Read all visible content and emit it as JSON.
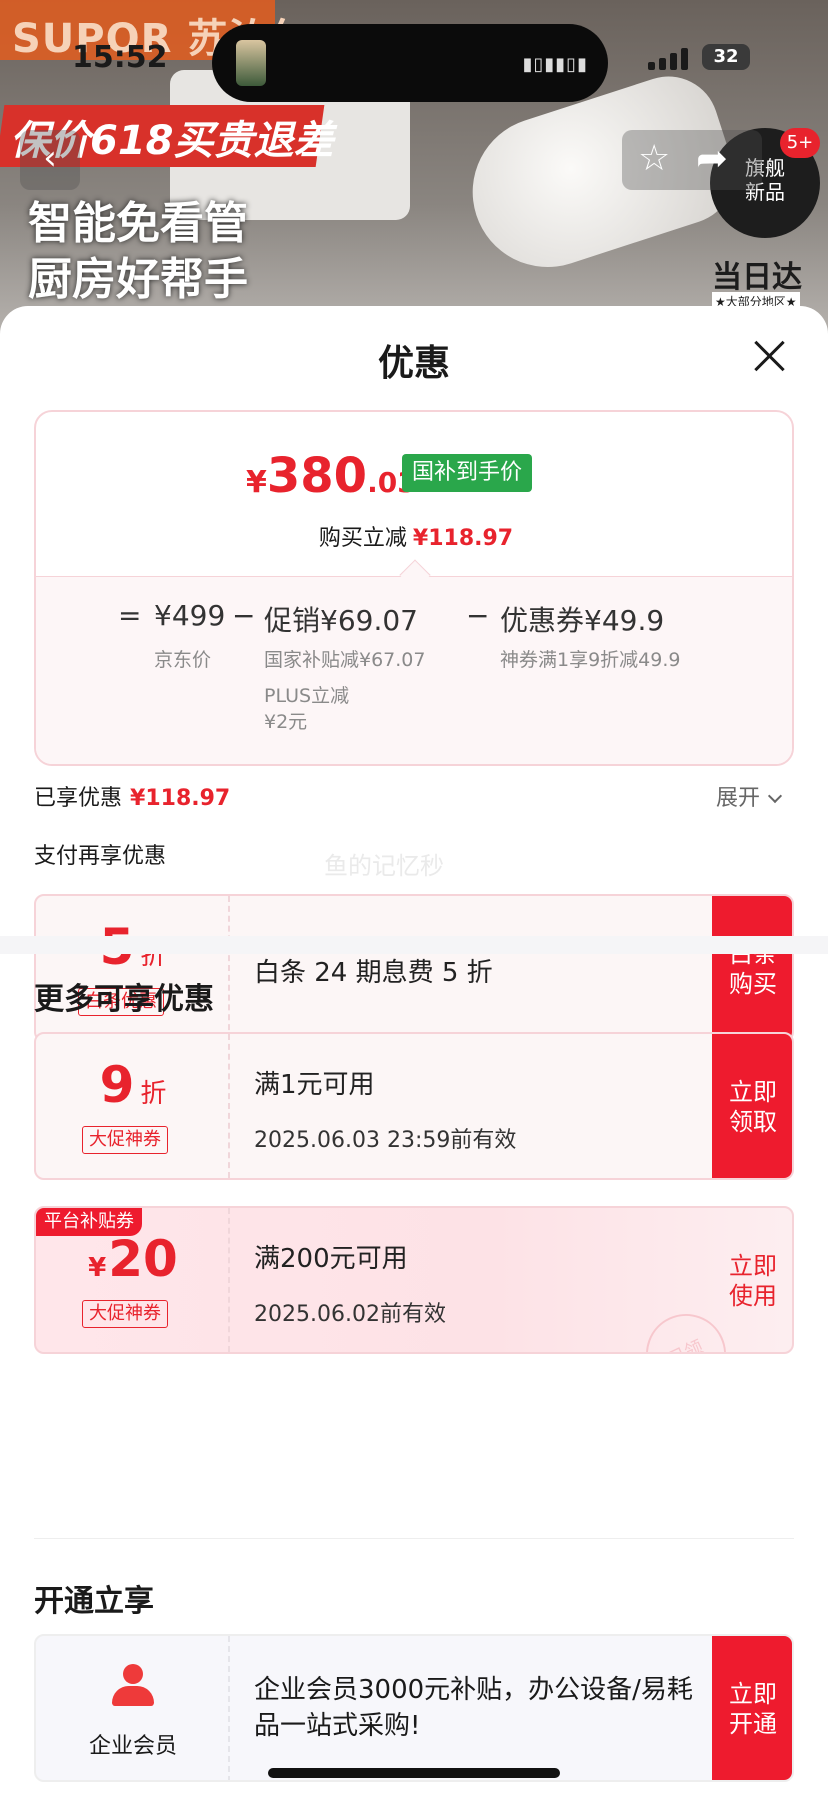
{
  "status_bar": {
    "time": "15:52",
    "battery": "32"
  },
  "background": {
    "brand": "SUPOR 苏泊尔",
    "promo": "保价618买贵退差",
    "slogan_line1": "智能免看管",
    "slogan_line2": "厨房好帮手",
    "seal_line1": "旗舰",
    "seal_line2": "新品",
    "today": "当日达",
    "today_sub": "★大部分地区★",
    "badge": "5+"
  },
  "sheet": {
    "title": "优惠"
  },
  "price_card": {
    "currency": "¥",
    "price_int": "380",
    "price_dec": ".03",
    "gov_tag": "国补到手价",
    "buy_reduce_label": "购买立减",
    "buy_reduce_value": "¥118.97",
    "calc": {
      "eq": "=",
      "jd_price": "¥499",
      "jd_label": "京东价",
      "minus1": "−",
      "promo": "促销¥69.07",
      "promo_sub1": "国家补贴减¥67.07",
      "promo_sub2": "PLUS立减",
      "promo_sub3": "¥2元",
      "minus2": "−",
      "coupon": "优惠券¥49.9",
      "coupon_sub": "神券满1享9折减49.9"
    }
  },
  "enjoyed": {
    "label": "已享优惠",
    "value": "¥118.97",
    "expand": "展开"
  },
  "pay_more": {
    "label": "支付再享优惠",
    "watermark": "鱼的记忆秒"
  },
  "baitiao": {
    "num": "5",
    "unit": "折",
    "tag": "白条优惠",
    "desc": "白条 24 期息费 5 折",
    "action": "白条\n购买"
  },
  "more_section": {
    "title": "更多可享优惠"
  },
  "coupons": [
    {
      "num": "9",
      "unit": "折",
      "tag": "大促神券",
      "desc": "满1元可用",
      "expiry": "2025.06.03 23:59前有效",
      "action": "立即\n领取"
    },
    {
      "corner": "平台补贴券",
      "currency": "¥",
      "num": "20",
      "tag": "大促神券",
      "desc": "满200元可用",
      "expiry": "2025.06.02前有效",
      "action": "立即\n使用",
      "stamp": "已领"
    }
  ],
  "open_section": {
    "title": "开通立享"
  },
  "member": {
    "label": "企业会员",
    "desc": "企业会员3000元补贴，办公设备/易耗品一站式采购!",
    "action": "立即\n开通"
  }
}
